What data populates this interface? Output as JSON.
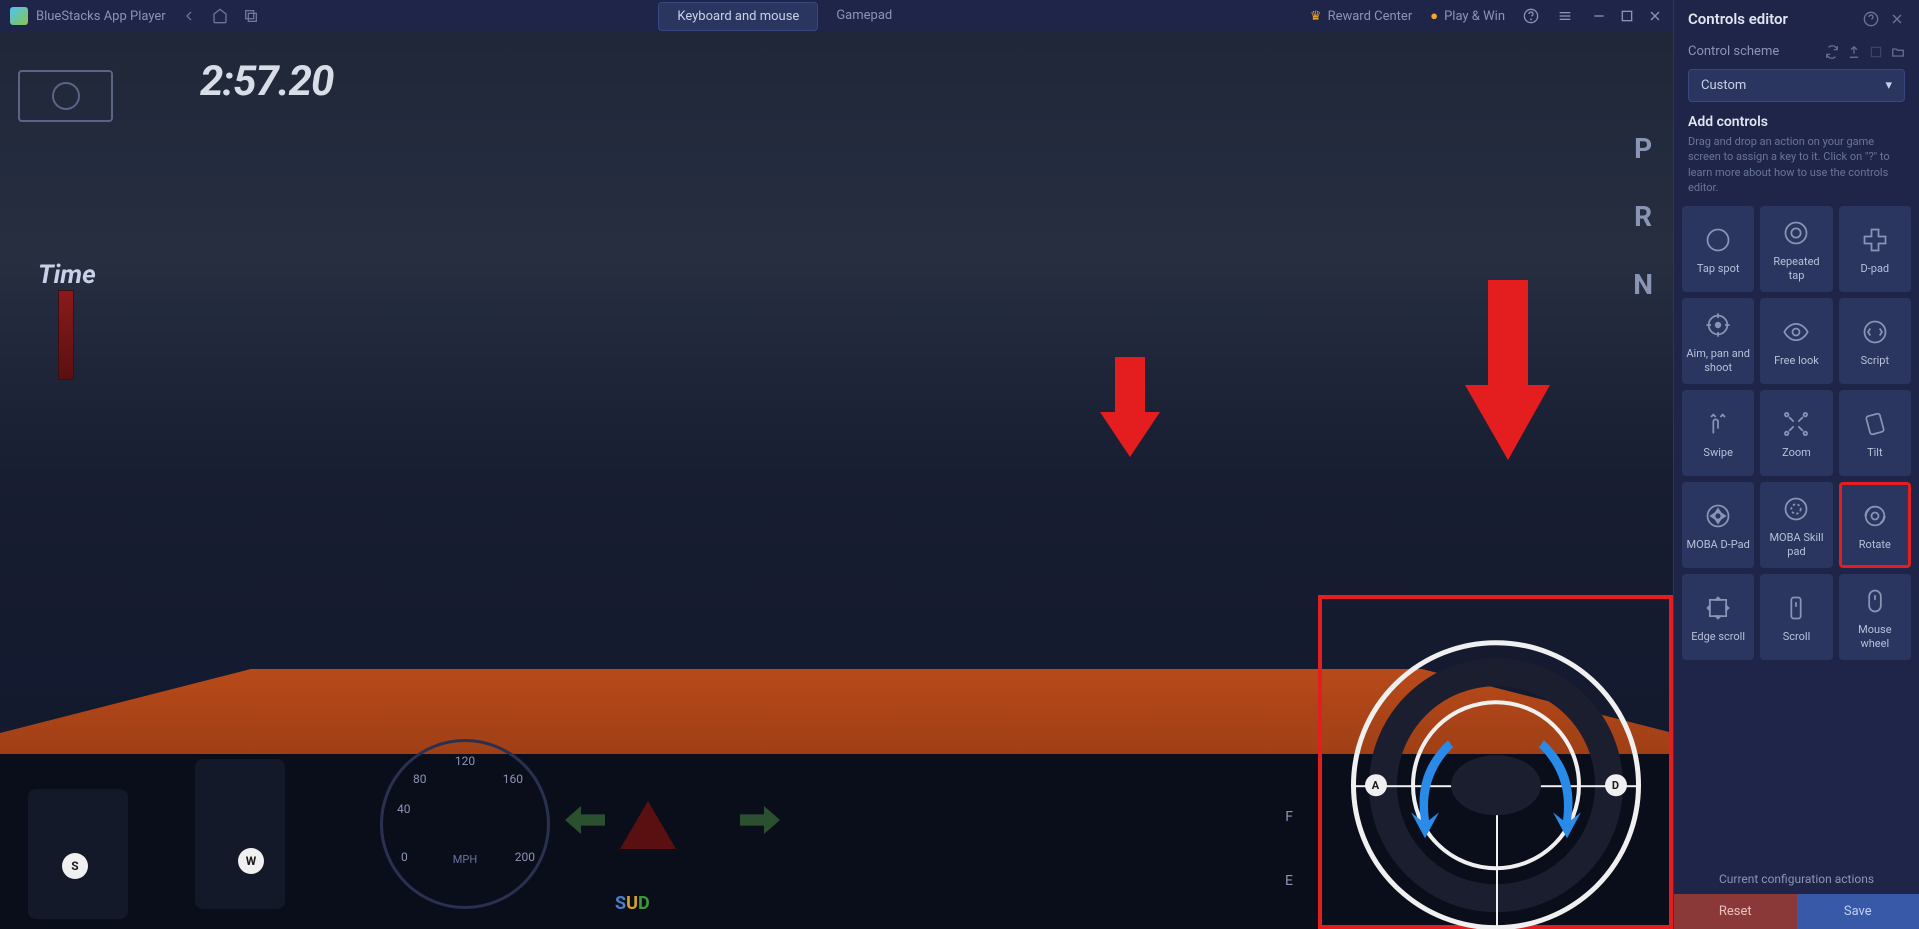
{
  "topbar": {
    "app_name": "BlueStacks App Player",
    "tab_keyboard": "Keyboard and mouse",
    "tab_gamepad": "Gamepad",
    "reward_center": "Reward Center",
    "play_win": "Play & Win"
  },
  "game": {
    "timer": "2:57.20",
    "time_label": "Time",
    "gear_p": "P",
    "gear_r": "R",
    "gear_n": "N",
    "key_s": "S",
    "key_w": "W",
    "key_a": "A",
    "key_d": "D",
    "mph": "MPH",
    "speed_0": "0",
    "speed_40": "40",
    "speed_80": "80",
    "speed_120": "120",
    "speed_160": "160",
    "speed_200": "200",
    "fuel_f": "F",
    "fuel_e": "E"
  },
  "panel": {
    "title": "Controls editor",
    "scheme_label": "Control scheme",
    "scheme_value": "Custom",
    "add_title": "Add controls",
    "add_desc": "Drag and drop an action on your game screen to assign a key to it. Click on \"?\" to learn more about how to use the controls editor.",
    "controls": {
      "tap_spot": "Tap spot",
      "repeated_tap": "Repeated tap",
      "dpad": "D-pad",
      "aim_pan_shoot": "Aim, pan and shoot",
      "free_look": "Free look",
      "script": "Script",
      "swipe": "Swipe",
      "zoom": "Zoom",
      "tilt": "Tilt",
      "moba_dpad": "MOBA D-Pad",
      "moba_skill": "MOBA Skill pad",
      "rotate": "Rotate",
      "edge_scroll": "Edge scroll",
      "scroll": "Scroll",
      "mouse_wheel": "Mouse wheel"
    },
    "config_label": "Current configuration actions",
    "reset": "Reset",
    "save": "Save"
  }
}
